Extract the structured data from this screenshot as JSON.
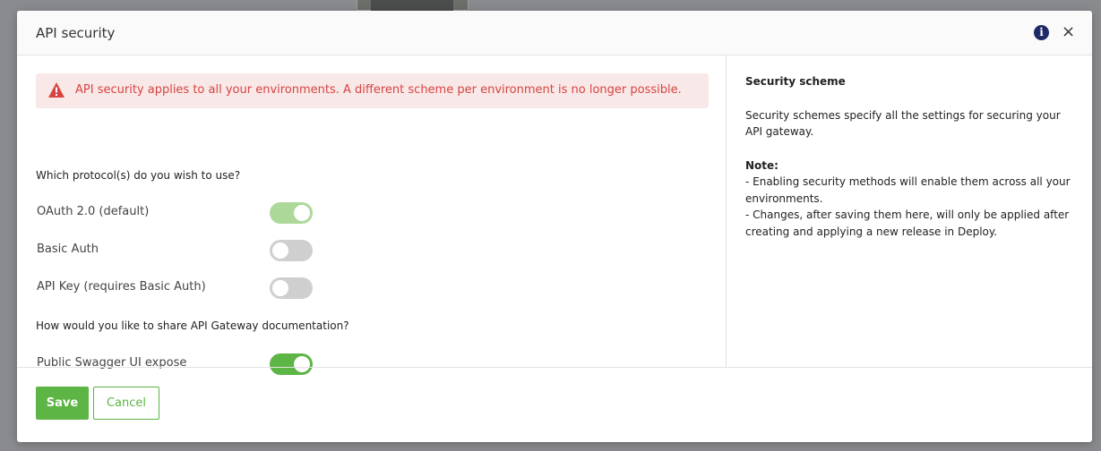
{
  "modal": {
    "title": "API security",
    "close_symbol": "×",
    "info_symbol": "i"
  },
  "alert": {
    "icon": "warning-triangle-icon",
    "text": "API security applies to all your environments. A different scheme per environment is no longer possible.",
    "color": "#d64541"
  },
  "protocols": {
    "question": "Which protocol(s) do you wish to use?",
    "items": [
      {
        "label": "OAuth 2.0 (default)",
        "enabled": true,
        "disabled": true
      },
      {
        "label": "Basic Auth",
        "enabled": false,
        "disabled": false
      },
      {
        "label": "API Key (requires Basic Auth)",
        "enabled": false,
        "disabled": false
      }
    ]
  },
  "documentation": {
    "question": "How would you like to share API Gateway documentation?",
    "items": [
      {
        "label": "Public Swagger UI expose",
        "enabled": true,
        "disabled": false
      }
    ]
  },
  "help": {
    "title": "Security scheme",
    "description": "Security schemes specify all the settings for securing your API gateway.",
    "note_title": "Note:",
    "note_line1": "- Enabling security methods will enable them across all your environments.",
    "note_line2": "- Changes, after saving them here, will only be applied after creating and applying a new release in Deploy."
  },
  "footer": {
    "save_label": "Save",
    "cancel_label": "Cancel"
  },
  "colors": {
    "accent": "#5cb544",
    "accent_disabled": "#acd99a",
    "toggle_off": "#cfcfcf",
    "info_icon": "#1d2a66"
  }
}
